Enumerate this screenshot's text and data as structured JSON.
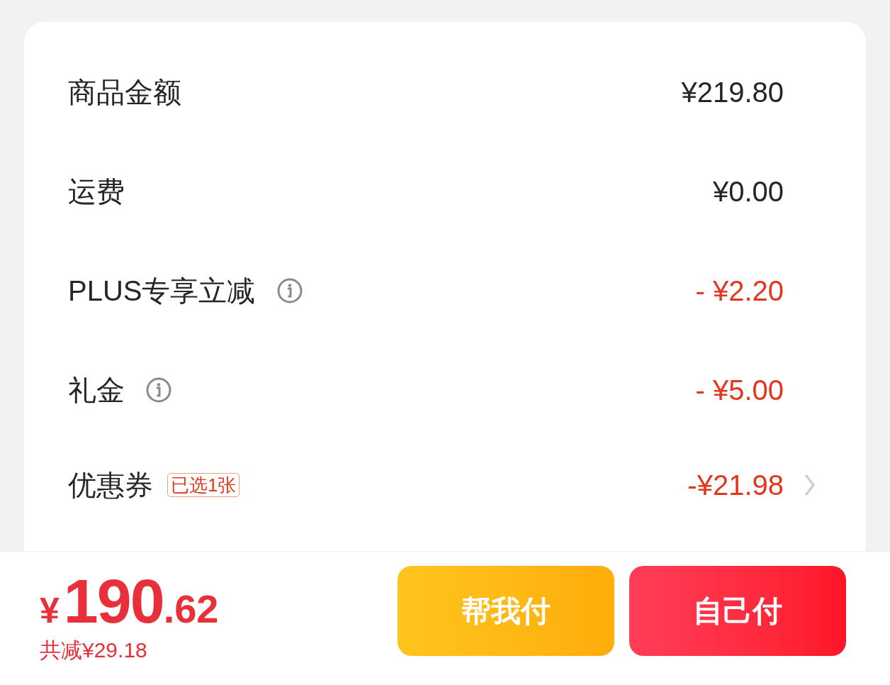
{
  "summary_rows": [
    {
      "kind": "plain",
      "label": "商品金额",
      "amount": "¥219.80",
      "discount": false
    },
    {
      "kind": "plain",
      "label": "运费",
      "amount": "¥0.00",
      "discount": false
    },
    {
      "kind": "info",
      "label": "PLUS专享立减",
      "amount": "- ¥2.20",
      "discount": true
    },
    {
      "kind": "info",
      "label": "礼金",
      "amount": "- ¥5.00",
      "discount": true
    },
    {
      "kind": "coupon",
      "label": "优惠券",
      "tag": "已选1张",
      "amount": "-¥21.98",
      "discount": true
    }
  ],
  "footer": {
    "total": {
      "currency": "¥",
      "integer": "190",
      "decimal": ".62"
    },
    "savings": "共减¥29.18",
    "buttons": [
      {
        "kind": "secondary",
        "label": "帮我付"
      },
      {
        "kind": "primary",
        "label": "自己付"
      }
    ]
  }
}
